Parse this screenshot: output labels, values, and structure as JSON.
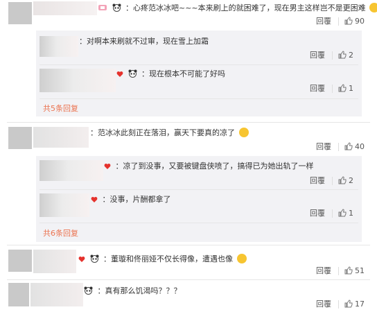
{
  "comments": [
    {
      "text": "：心疼范冰冰吧~~~本来刷上的就困难了，现在男主这样岂不是更困难",
      "reply_label": "回覆",
      "likes": "90",
      "replies": [
        {
          "text": "：对啊本来刷就不过审，现在雪上加霜",
          "reply_label": "回覆",
          "likes": "2"
        },
        {
          "text": "：现在根本不可能了好吗",
          "reply_label": "回覆",
          "likes": "1"
        }
      ],
      "more_replies": "共5条回复"
    },
    {
      "text": "：范冰冰此刻正在落泪，赢天下要真的凉了",
      "reply_label": "回覆",
      "likes": "40",
      "replies": [
        {
          "text": "：凉了到没事，又要被键盘侠喷了，搞得已为她出轨了一样",
          "reply_label": "回覆",
          "likes": "2"
        },
        {
          "text": "：没事，片酬都拿了",
          "reply_label": "回覆",
          "likes": "1"
        }
      ],
      "more_replies": "共6条回复"
    },
    {
      "text": "：董璇和佟丽娅不仅长得像，遭遇也像",
      "reply_label": "回覆",
      "likes": "51"
    },
    {
      "text": "：真有那么饥渴吗？？？",
      "reply_label": "回覆",
      "likes": "17"
    }
  ],
  "colors": {
    "accent": "#eb7350",
    "text": "#333333",
    "muted": "#555555",
    "nested_bg": "#f2f2f5"
  },
  "icons": {
    "like": "thumbs-up-icon",
    "badge": "panda-icon"
  }
}
